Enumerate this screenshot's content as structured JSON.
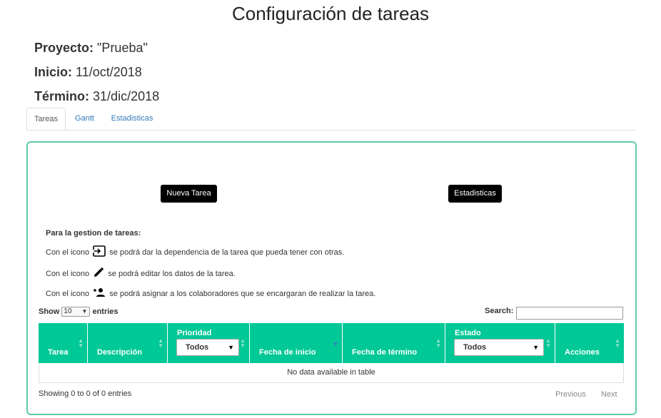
{
  "page": {
    "title": "Configuración de tareas"
  },
  "project": {
    "proyecto_label": "Proyecto:",
    "proyecto_value": "\"Prueba\"",
    "inicio_label": "Inicio:",
    "inicio_value": "11/oct/2018",
    "termino_label": "Término:",
    "termino_value": "31/dic/2018"
  },
  "tabs": [
    {
      "label": "Tareas",
      "active": true
    },
    {
      "label": "Gantt",
      "active": false
    },
    {
      "label": "Estadisticas",
      "active": false
    }
  ],
  "buttons": {
    "nueva_tarea": "Nueva Tarea",
    "estadisticas": "Estadisticas"
  },
  "help": {
    "title": "Para la gestion de tareas:",
    "line1_pre": "Con el icono",
    "line1_post": "se podrá dar la dependencia de la tarea que pueda tener con otras.",
    "line2_pre": "Con el icono",
    "line2_post": "se podrá editar los datos de la tarea.",
    "line3_pre": "Con el icono",
    "line3_post": "se podrá asignar a los colaboradores que se encargaran de realizar la tarea.",
    "icons": [
      "dependency-icon",
      "pencil-icon",
      "add-person-icon"
    ]
  },
  "table_controls": {
    "show_label": "Show",
    "entries_value": "10",
    "entries_label": "entries",
    "search_label": "Search:",
    "search_value": ""
  },
  "table": {
    "columns": [
      {
        "label": "Tarea"
      },
      {
        "label": "Descripción"
      },
      {
        "label": "Prioridad",
        "filter": "Todos"
      },
      {
        "label": "Fecha de inicio"
      },
      {
        "label": "Fecha de término"
      },
      {
        "label": "Estado",
        "filter": "Todos"
      },
      {
        "label": "Acciones"
      }
    ],
    "empty_message": "No data available in table",
    "header_color": "#00c896"
  },
  "footer": {
    "info": "Showing 0 to 0 of 0 entries",
    "previous": "Previous",
    "next": "Next"
  },
  "colors": {
    "panel_border": "#5fcca6",
    "accent_link": "#337ab7",
    "button_bg": "#000000"
  }
}
